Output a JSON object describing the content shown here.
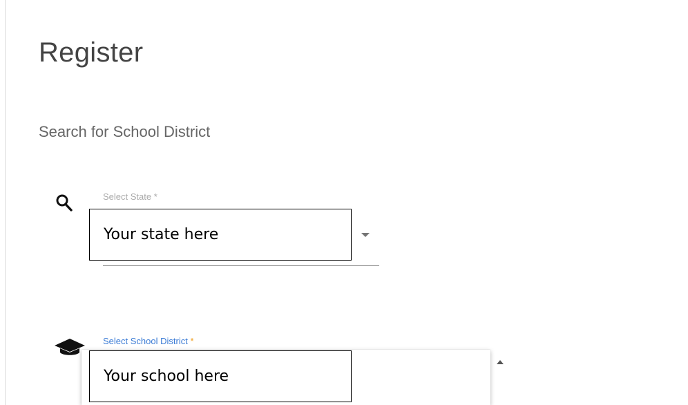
{
  "page": {
    "title": "Register",
    "subtitle": "Search for School District"
  },
  "state_field": {
    "label": "Select State",
    "required_mark": "*",
    "value": "Your state here",
    "icon": "search-icon"
  },
  "district_field": {
    "label": "Select School District",
    "required_mark": "*",
    "value": "Your school here",
    "icon": "graduation-cap-icon"
  },
  "colors": {
    "active_label": "#3a7bd5",
    "required_mark_active": "#f0a020",
    "text_primary": "#444444"
  }
}
